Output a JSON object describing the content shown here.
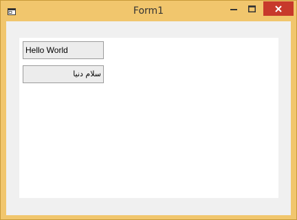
{
  "window": {
    "title": "Form1",
    "title_color": "#333333",
    "frame_color": "#f1c66d",
    "close_button_color": "#c7392b"
  },
  "icons": {
    "app": "window-icon",
    "minimize": "minimize-icon",
    "maximize": "maximize-icon",
    "close": "close-icon"
  },
  "form": {
    "textbox_english": {
      "value": "Hello World"
    },
    "textbox_arabic": {
      "value": "سلام دنیا"
    }
  }
}
